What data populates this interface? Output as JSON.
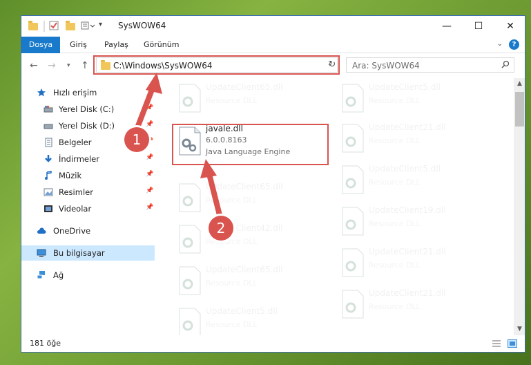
{
  "window": {
    "title": "SysWOW64"
  },
  "ribbon": {
    "tabs": [
      "Dosya",
      "Giriş",
      "Paylaş",
      "Görünüm"
    ],
    "help": "?"
  },
  "address": {
    "path": "C:\\Windows\\SysWOW64",
    "search_placeholder": "Ara: SysWOW64"
  },
  "sidebar": {
    "items": [
      {
        "label": "Hızlı erişim",
        "icon": "star-icon"
      },
      {
        "label": "Yerel Disk (C:)",
        "icon": "drive-icon",
        "pinned": true
      },
      {
        "label": "Yerel Disk (D:)",
        "icon": "drive-icon",
        "pinned": true
      },
      {
        "label": "Belgeler",
        "icon": "document-icon",
        "pinned": true
      },
      {
        "label": "İndirmeler",
        "icon": "download-icon",
        "pinned": true
      },
      {
        "label": "Müzik",
        "icon": "music-icon",
        "pinned": true
      },
      {
        "label": "Resimler",
        "icon": "picture-icon",
        "pinned": true
      },
      {
        "label": "Videolar",
        "icon": "video-icon",
        "pinned": true
      },
      {
        "label": "OneDrive",
        "icon": "cloud-icon"
      },
      {
        "label": "Bu bilgisayar",
        "icon": "computer-icon",
        "selected": true
      },
      {
        "label": "Ağ",
        "icon": "network-icon"
      }
    ]
  },
  "files": {
    "left": [
      {
        "name": "UpdateClient65.dll",
        "desc": "Resource DLL"
      },
      {
        "name": "javale.dll",
        "version": "6.0.0.8163",
        "desc": "Java Language Engine",
        "active": true
      },
      {
        "name": "UpdateClient65.dll",
        "desc": "Resource DLL"
      },
      {
        "name": "UpdateClient42.dll",
        "desc": "Resource DLL"
      },
      {
        "name": "UpdateClient65.dll",
        "desc": "Resource DLL"
      },
      {
        "name": "UpdateClient5.dll",
        "desc": "Resource DLL"
      }
    ],
    "right": [
      {
        "name": "UpdateClient5.dll",
        "desc": "Resource DLL"
      },
      {
        "name": "UpdateClient21.dll",
        "desc": "Resource DLL"
      },
      {
        "name": "UpdateClient5.dll",
        "desc": "Resource DLL"
      },
      {
        "name": "UpdateClient19.dll",
        "desc": "Resource DLL"
      },
      {
        "name": "UpdateClient21.dll",
        "desc": "Resource DLL"
      },
      {
        "name": "UpdateClient21.dll",
        "desc": "Resource DLL"
      }
    ]
  },
  "status": {
    "count": "181 öğe"
  },
  "annotations": {
    "step1": "1",
    "step2": "2",
    "color": "#d9534f"
  }
}
